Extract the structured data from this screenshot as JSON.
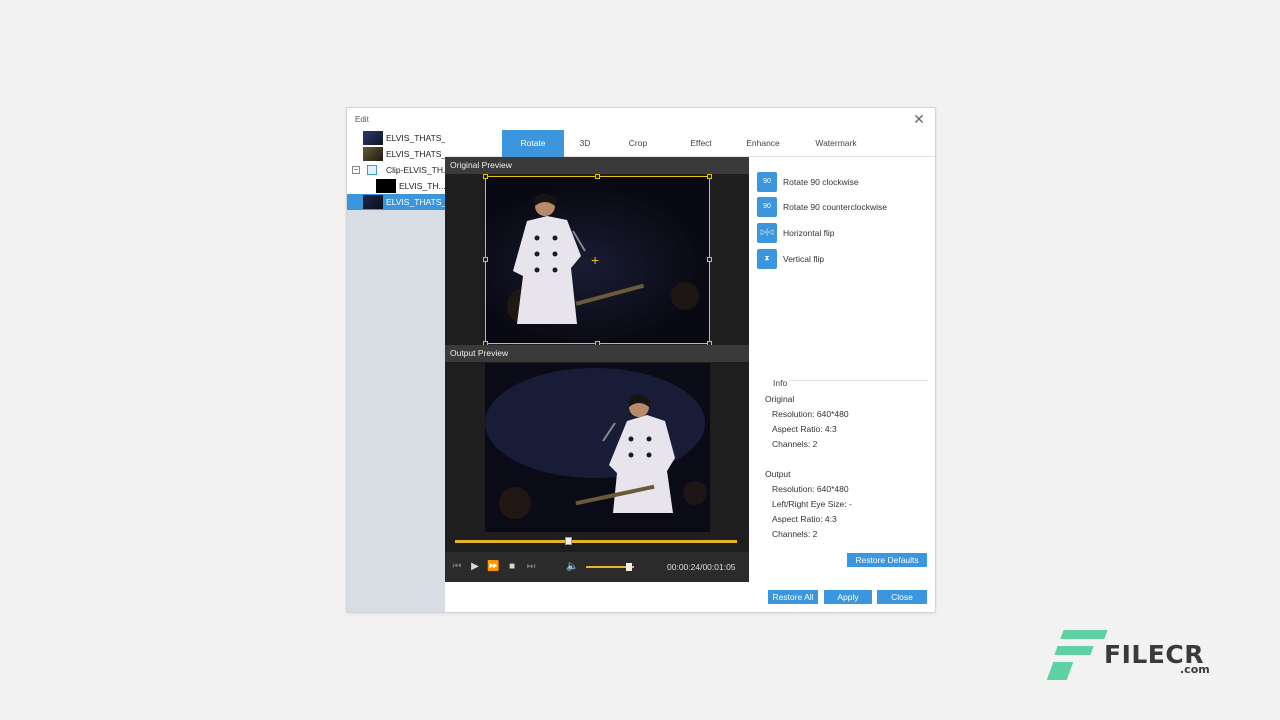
{
  "window": {
    "title": "Edit",
    "close_glyph": "✕"
  },
  "sidebar": {
    "items": [
      {
        "label": "ELVIS_THATS_",
        "thumb": "concert-thumb-blue",
        "selected": false
      },
      {
        "label": "ELVIS_THATS_",
        "thumb": "concert-thumb-warm",
        "selected": false
      },
      {
        "label": "Clip-ELVIS_TH...",
        "thumb": "clip-icon",
        "selected": false,
        "expander": "−"
      },
      {
        "label": "ELVIS_TH...",
        "thumb": "black-thumb",
        "selected": false
      },
      {
        "label": "ELVIS_THATS_",
        "thumb": "concert-thumb-dark",
        "selected": true
      }
    ]
  },
  "tabs": [
    {
      "label": "Rotate",
      "active": true
    },
    {
      "label": "3D",
      "active": false
    },
    {
      "label": "Crop",
      "active": false
    },
    {
      "label": "Effect",
      "active": false
    },
    {
      "label": "Enhance",
      "active": false
    },
    {
      "label": "Watermark",
      "active": false
    }
  ],
  "preview": {
    "original_label": "Original Preview",
    "output_label": "Output Preview",
    "timecode": "00:00:24/00:01:05",
    "progress": 0.4,
    "volume": 0.9
  },
  "actions": [
    {
      "label": "Rotate 90 clockwise",
      "icon": "rotate-cw-icon",
      "glyph": "90"
    },
    {
      "label": "Rotate 90 counterclockwise",
      "icon": "rotate-ccw-icon",
      "glyph": "90"
    },
    {
      "label": "Horizontal flip",
      "icon": "horizontal-flip-icon",
      "glyph": "▷|◁"
    },
    {
      "label": "Vertical flip",
      "icon": "vertical-flip-icon",
      "glyph": "⧗"
    }
  ],
  "info": {
    "legend": "Info",
    "original": {
      "heading": "Original",
      "resolution": "Resolution: 640*480",
      "aspect": "Aspect Ratio: 4:3",
      "channels": "Channels: 2"
    },
    "output": {
      "heading": "Output",
      "resolution": "Resolution: 640*480",
      "eye_size": "Left/Right Eye Size: -",
      "aspect": "Aspect Ratio: 4:3",
      "channels": "Channels: 2"
    },
    "restore_defaults": "Restore Defaults"
  },
  "footer": {
    "restore_all": "Restore All",
    "apply": "Apply",
    "close": "Close"
  },
  "watermark": {
    "brand": "FILECR",
    "domain": ".com"
  },
  "colors": {
    "accent": "#3c96de",
    "crop": "#e4c400",
    "timeline": "#e4b52a",
    "logo": "#5fd0a1"
  }
}
